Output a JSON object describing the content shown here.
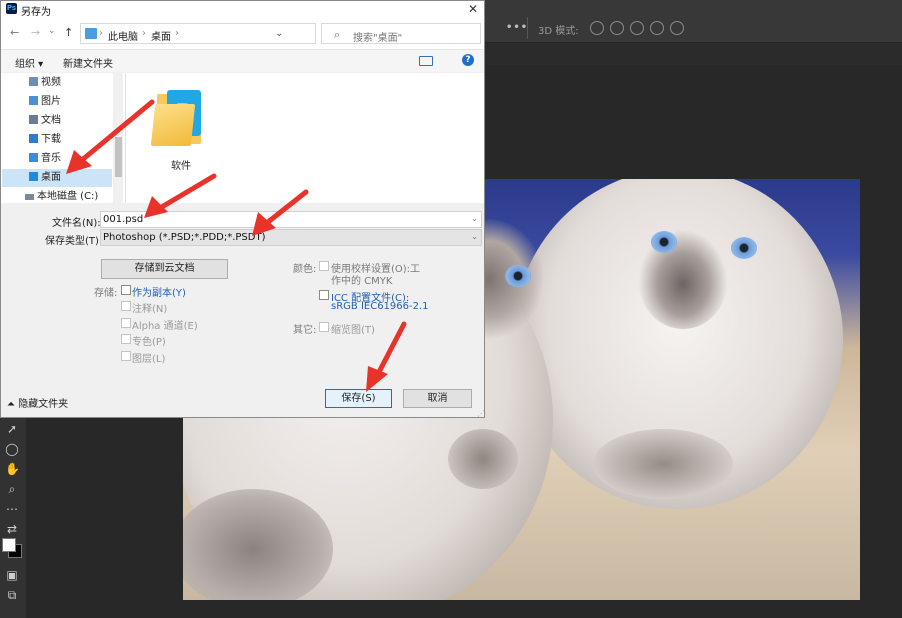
{
  "photoshop": {
    "more": "•••",
    "mode_3d": "3D 模式:"
  },
  "dialog": {
    "app_icon": "Ps",
    "title": "另存为",
    "close": "✕",
    "nav": {
      "back": "←",
      "forward": "→",
      "dropdown": "⌄",
      "up": "↑",
      "refresh": "↻"
    },
    "breadcrumb": [
      "此电脑",
      "桌面"
    ],
    "crumb_sep": "›",
    "address_dropdown": "⌄",
    "search_placeholder": "搜索\"桌面\"",
    "search_icon": "⌕",
    "toolbar": {
      "organize": "组织 ▾",
      "new_folder": "新建文件夹",
      "help": "?"
    },
    "sidebar": [
      {
        "label": "视频",
        "icon": "video-folder-icon",
        "color": "#6b8fb8"
      },
      {
        "label": "图片",
        "icon": "pictures-folder-icon",
        "color": "#4a90d9"
      },
      {
        "label": "文档",
        "icon": "documents-folder-icon",
        "color": "#6b7c93"
      },
      {
        "label": "下载",
        "icon": "downloads-folder-icon",
        "color": "#2b7cd3"
      },
      {
        "label": "音乐",
        "icon": "music-folder-icon",
        "color": "#3c8be0"
      },
      {
        "label": "桌面",
        "icon": "desktop-folder-icon",
        "color": "#1f8be0",
        "selected": true
      },
      {
        "label": "本地磁盘 (C:)",
        "icon": "drive-icon",
        "color": "#7a8a9a"
      }
    ],
    "files": [
      {
        "name": "软件",
        "icon": "folder-icon"
      }
    ],
    "filename_label": "文件名(N):",
    "filename_value": "001.psd",
    "filetype_label": "保存类型(T):",
    "filetype_value": "Photoshop (*.PSD;*.PDD;*.PSDT)",
    "save_to_cloud": "存储到云文档",
    "save_group_label": "存储:",
    "save_options": [
      {
        "label": "作为副本(Y)",
        "enabled": true
      },
      {
        "label": "注释(N)",
        "enabled": false
      },
      {
        "label": "Alpha 通道(E)",
        "enabled": false
      },
      {
        "label": "专色(P)",
        "enabled": false
      },
      {
        "label": "图层(L)",
        "enabled": false
      }
    ],
    "color_label": "颜色:",
    "proof_setup_line1": "使用校样设置(O):",
    "proof_setup_value1": "工",
    "proof_setup_line2": "作中的 CMYK",
    "icc_line1": "ICC 配置文件(C):",
    "icc_line2": "sRGB IEC61966-2.1",
    "other_label": "其它:",
    "thumbnail": "缩览图(T)",
    "hide_folders": "隐藏文件夹",
    "save_button": "保存(S)",
    "cancel_button": "取消"
  },
  "colors": {
    "accent": "#0078d7",
    "annotation_arrow": "#e8322a"
  }
}
